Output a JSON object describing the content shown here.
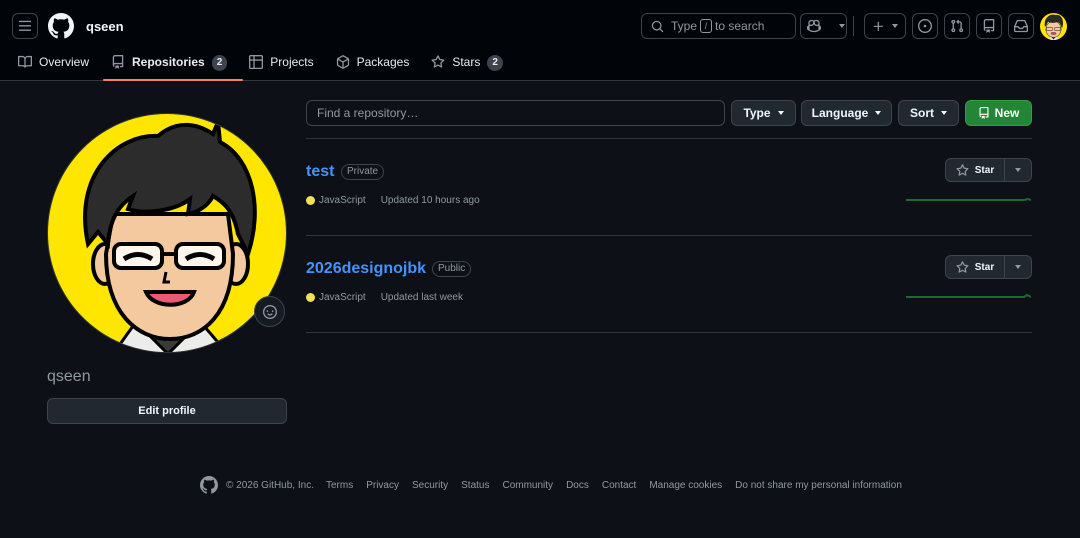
{
  "header": {
    "username": "qseen",
    "search": {
      "prefix": "Type",
      "key": "/",
      "suffix": "to search"
    }
  },
  "tabs": [
    {
      "label": "Overview"
    },
    {
      "label": "Repositories",
      "count": "2"
    },
    {
      "label": "Projects"
    },
    {
      "label": "Packages"
    },
    {
      "label": "Stars",
      "count": "2"
    }
  ],
  "profile": {
    "username": "qseen",
    "edit_label": "Edit profile"
  },
  "toolbar": {
    "find_placeholder": "Find a repository…",
    "type_label": "Type",
    "language_label": "Language",
    "sort_label": "Sort",
    "new_label": "New"
  },
  "repos": [
    {
      "name": "test",
      "visibility": "Private",
      "language": "JavaScript",
      "updated": "Updated 10 hours ago",
      "star_label": "Star"
    },
    {
      "name": "2026designojbk",
      "visibility": "Public",
      "language": "JavaScript",
      "updated": "Updated last week",
      "star_label": "Star"
    }
  ],
  "footer": {
    "copyright": "© 2026 GitHub, Inc.",
    "links": [
      "Terms",
      "Privacy",
      "Security",
      "Status",
      "Community",
      "Docs",
      "Contact",
      "Manage cookies",
      "Do not share my personal information"
    ]
  },
  "colors": {
    "javascript": "#f1e05a",
    "accent_link": "#4493f8",
    "primary_button": "#238636",
    "tab_underline": "#f78166",
    "avatar_background": "#ffe600"
  },
  "icons": [
    "menu-icon",
    "github-logo-icon",
    "search-icon",
    "copilot-icon",
    "plus-icon",
    "issues-icon",
    "pull-request-icon",
    "repo-icon",
    "inbox-icon",
    "book-icon",
    "table-icon",
    "package-icon",
    "star-icon",
    "smiley-icon"
  ]
}
